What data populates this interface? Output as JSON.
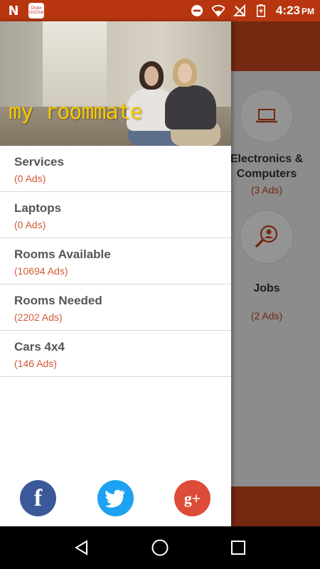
{
  "status_bar": {
    "notification_icons": [
      "n-icon",
      "order-on-chat-icon"
    ],
    "app_badge_text": "Order OnChat",
    "time": "4:23",
    "ampm": "PM"
  },
  "background": {
    "tiles": [
      {
        "title": "Electronics & Computers",
        "count": "(3 Ads)",
        "icon": "laptop-icon"
      },
      {
        "title": "Jobs",
        "count": "(2 Ads)",
        "icon": "job-search-icon"
      }
    ],
    "accent": "#c8451a"
  },
  "drawer": {
    "brand": "my roommate",
    "items": [
      {
        "name": "Services",
        "count": "(0 Ads)"
      },
      {
        "name": "Laptops",
        "count": "(0 Ads)"
      },
      {
        "name": "Rooms Available",
        "count": "(10694 Ads)"
      },
      {
        "name": "Rooms Needed",
        "count": "(2202 Ads)"
      },
      {
        "name": "Cars 4x4",
        "count": "(146 Ads)"
      }
    ],
    "social": [
      {
        "name": "facebook",
        "glyph": "f",
        "color": "#3b5998"
      },
      {
        "name": "twitter",
        "glyph": "",
        "color": "#1da1f2"
      },
      {
        "name": "google-plus",
        "glyph": "g+",
        "color": "#dd4b39"
      }
    ]
  },
  "nav": [
    "back",
    "home",
    "recents"
  ]
}
